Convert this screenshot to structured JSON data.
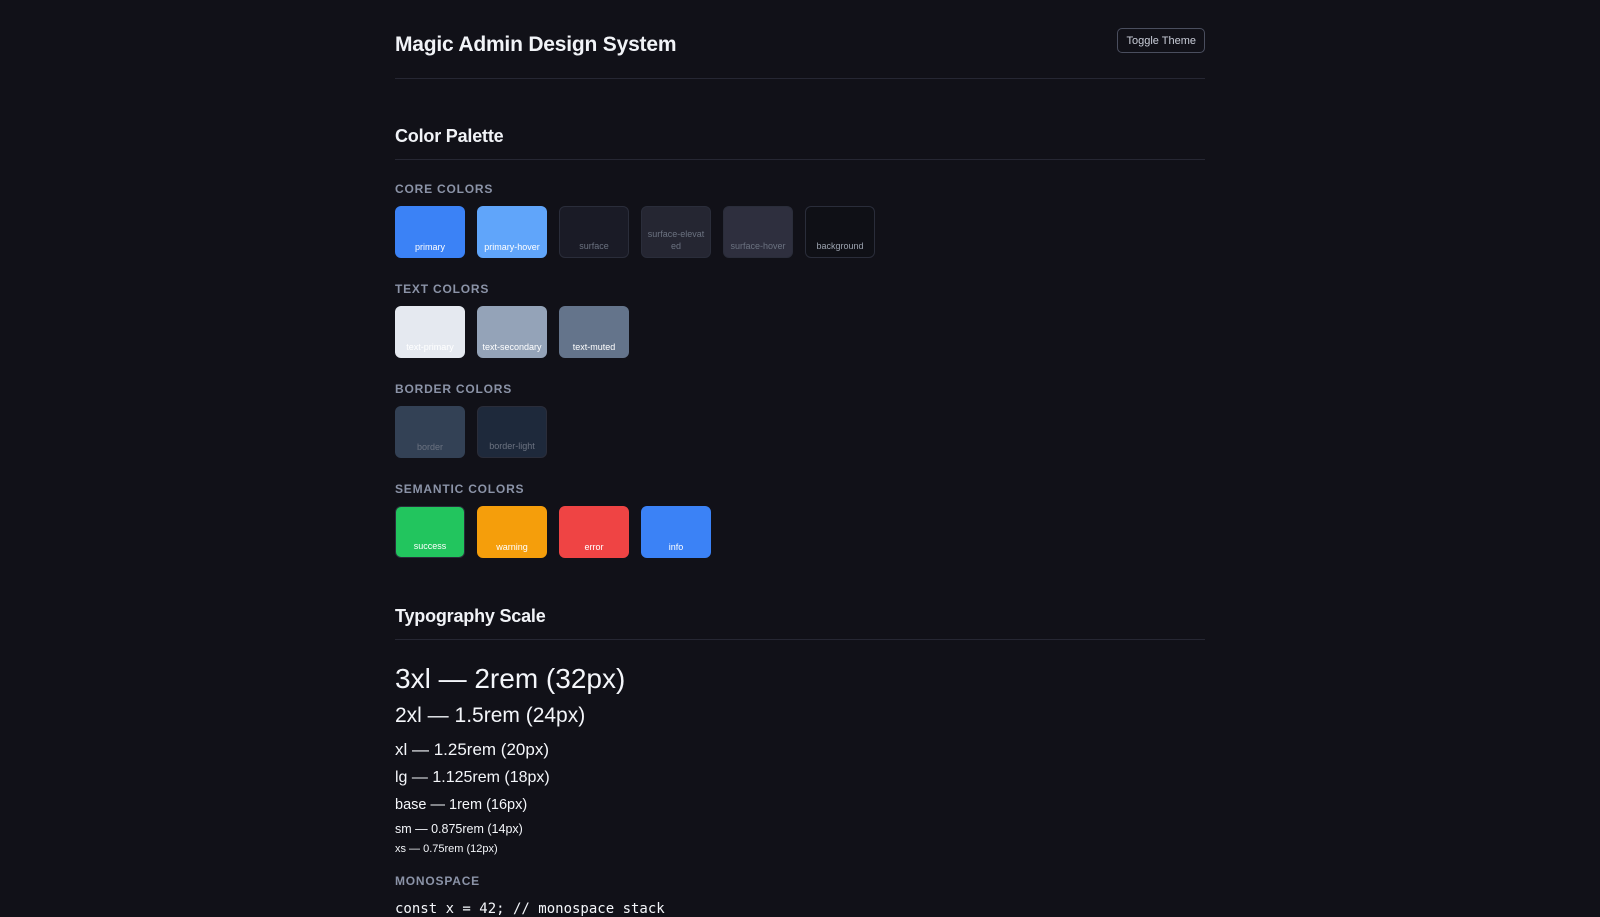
{
  "header": {
    "title": "Magic Admin Design System",
    "toggle_label": "Toggle Theme"
  },
  "palette": {
    "title": "Color Palette",
    "groups": [
      {
        "label": "CORE COLORS",
        "swatches": [
          {
            "name": "primary",
            "color": "#3b82f6",
            "text_color": "#ffffff"
          },
          {
            "name": "primary-hover",
            "color": "#60a5fa",
            "text_color": "#ffffff"
          },
          {
            "name": "surface",
            "color": "#1a1b26",
            "text_color": "#6b7280"
          },
          {
            "name": "surface-elevated",
            "color": "#252632",
            "text_color": "#6b7280"
          },
          {
            "name": "surface-hover",
            "color": "#2e2f3e",
            "text_color": "#6b7280"
          },
          {
            "name": "background",
            "color": "#0f1016",
            "text_color": "#9ca3af"
          }
        ]
      },
      {
        "label": "TEXT COLORS",
        "swatches": [
          {
            "name": "text-primary",
            "color": "#e5e9f0",
            "text_color": "#ffffff"
          },
          {
            "name": "text-secondary",
            "color": "#94a3b8",
            "text_color": "#ffffff"
          },
          {
            "name": "text-muted",
            "color": "#64748b",
            "text_color": "#ffffff"
          }
        ]
      },
      {
        "label": "BORDER COLORS",
        "swatches": [
          {
            "name": "border",
            "color": "#334155",
            "text_color": "#6b7280"
          },
          {
            "name": "border-light",
            "color": "#1e293b",
            "text_color": "#6b7280"
          }
        ]
      },
      {
        "label": "SEMANTIC COLORS",
        "swatches": [
          {
            "name": "success",
            "color": "#22c55e",
            "text_color": "#ffffff"
          },
          {
            "name": "warning",
            "color": "#f59e0b",
            "text_color": "#ffffff"
          },
          {
            "name": "error",
            "color": "#ef4444",
            "text_color": "#ffffff"
          },
          {
            "name": "info",
            "color": "#3b82f6",
            "text_color": "#ffffff"
          }
        ]
      }
    ]
  },
  "typography": {
    "title": "Typography Scale",
    "items": [
      {
        "size": "3xl",
        "label": "3xl — 2rem (32px)"
      },
      {
        "size": "2xl",
        "label": "2xl — 1.5rem (24px)"
      },
      {
        "size": "xl",
        "label": "xl — 1.25rem (20px)"
      },
      {
        "size": "lg",
        "label": "lg — 1.125rem (18px)"
      },
      {
        "size": "base",
        "label": "base — 1rem (16px)"
      },
      {
        "size": "sm",
        "label": "sm — 0.875rem (14px)"
      },
      {
        "size": "xs",
        "label": "xs — 0.75rem (12px)"
      }
    ],
    "mono_label": "MONOSPACE",
    "mono_sample": "const x = 42; // monospace stack"
  }
}
